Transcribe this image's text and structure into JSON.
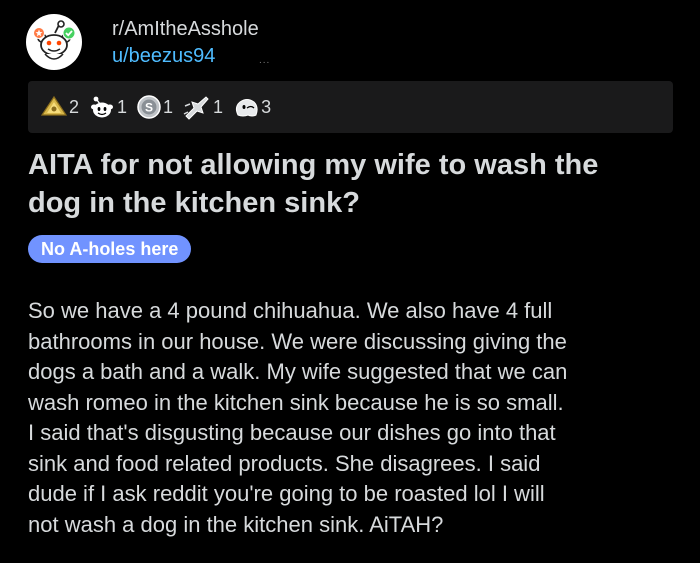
{
  "post": {
    "subreddit": "r/AmItheAsshole",
    "author": "u/beezus94",
    "more_menu": "...",
    "title": "AITA for not allowing my wife to wash the dog in the kitchen sink?",
    "title_lines": [
      "AITA for not allowing my wife to wash the",
      "dog in the kitchen sink?"
    ],
    "flair": "No A-holes here",
    "body_lines": [
      "So we have a 4 pound chihuahua.  We also have 4 full",
      "bathrooms in our house. We were discussing giving the",
      "dogs a bath and a walk. My wife suggested that we can",
      "wash romeo in the kitchen sink because he is so small.",
      "I said that's disgusting because our dishes go into that",
      "sink and food related products. She disagrees. I said",
      "dude if I ask reddit you're going to be roasted lol I will",
      "not wash a dog in the kitchen sink.  AiTAH?"
    ]
  },
  "awards": [
    {
      "icon": "helpful-award-icon",
      "count": "2"
    },
    {
      "icon": "wholesome-award-icon",
      "count": "1"
    },
    {
      "icon": "silver-award-icon",
      "count": "1"
    },
    {
      "icon": "rocket-like-award-icon",
      "count": "1"
    },
    {
      "icon": "ghost-facepalm-award-icon",
      "count": "3"
    }
  ],
  "colors": {
    "background": "#000000",
    "awards_bar": "#1a1a1b",
    "text": "#d7dadc",
    "username": "#4fbcff",
    "flair_bg": "#7193ff",
    "flair_text": "#ffffff"
  }
}
